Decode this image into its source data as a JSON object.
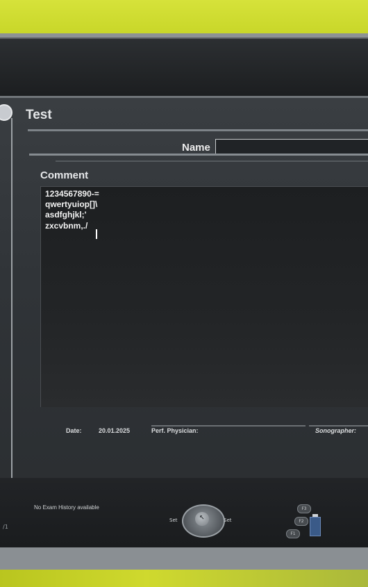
{
  "window": {
    "title": "Test"
  },
  "fields": {
    "name_label": "Name",
    "name_value": ""
  },
  "comment": {
    "label": "Comment",
    "lines": [
      "1234567890-=",
      "qwertyuiop[]\\",
      "asdfghjkl;'",
      "zxcvbnm,./"
    ]
  },
  "footer": {
    "date_label": "Date:",
    "date_value": "20.01.2025",
    "perf_physician_label": "Perf. Physician:",
    "sonographer_label": "Sonographer:"
  },
  "status": {
    "exam_history": "No Exam History available",
    "page_indicator": "/1"
  },
  "controls": {
    "set_left": "Set",
    "set_right": "Set",
    "fkeys": [
      "F3",
      "F2",
      "F1"
    ]
  },
  "colors": {
    "screen_bg": "#2f3236",
    "text": "#f2f2f2",
    "frame": "#5a5e60"
  }
}
